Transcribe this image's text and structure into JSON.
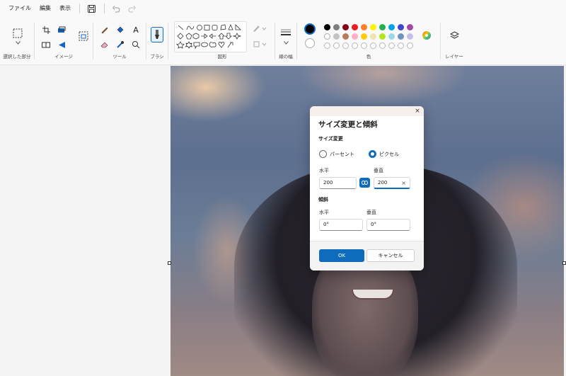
{
  "menu": {
    "file": "ファイル",
    "edit": "編集",
    "view": "表示"
  },
  "ribbon": {
    "selection_label": "選択した部分",
    "image_label": "イメージ",
    "tools_label": "ツール",
    "brush_label": "ブラシ",
    "shapes_label": "図形",
    "line_width_label": "線の幅",
    "colors_label": "色",
    "layers_label": "レイヤー",
    "text_tool_glyph": "A"
  },
  "palette": {
    "active_color": "#000000",
    "secondary_color": "#ffffff",
    "row1": [
      "#000000",
      "#7f7f7f",
      "#880015",
      "#ed1c24",
      "#ff7f27",
      "#fff200",
      "#22b14c",
      "#00a2e8",
      "#3f48cc",
      "#a349a4"
    ],
    "row2": [
      "#ffffff",
      "#c3c3c3",
      "#b97a57",
      "#ffaec9",
      "#ffc90e",
      "#efe4b0",
      "#b5e61d",
      "#99d9ea",
      "#7092be",
      "#c8bfe7"
    ]
  },
  "dialog": {
    "title": "サイズ変更と傾斜",
    "close": "×",
    "resize_section": "サイズ変更",
    "option_percent": "パーセント",
    "option_pixel": "ピクセル",
    "horizontal_label": "水平",
    "vertical_label": "垂直",
    "horizontal_value": "200",
    "vertical_value": "200",
    "skew_section": "傾斜",
    "skew_horizontal_label": "水平",
    "skew_vertical_label": "垂直",
    "skew_horizontal_value": "0°",
    "skew_vertical_value": "0°",
    "ok": "OK",
    "cancel": "キャンセル",
    "clear_glyph": "×"
  }
}
